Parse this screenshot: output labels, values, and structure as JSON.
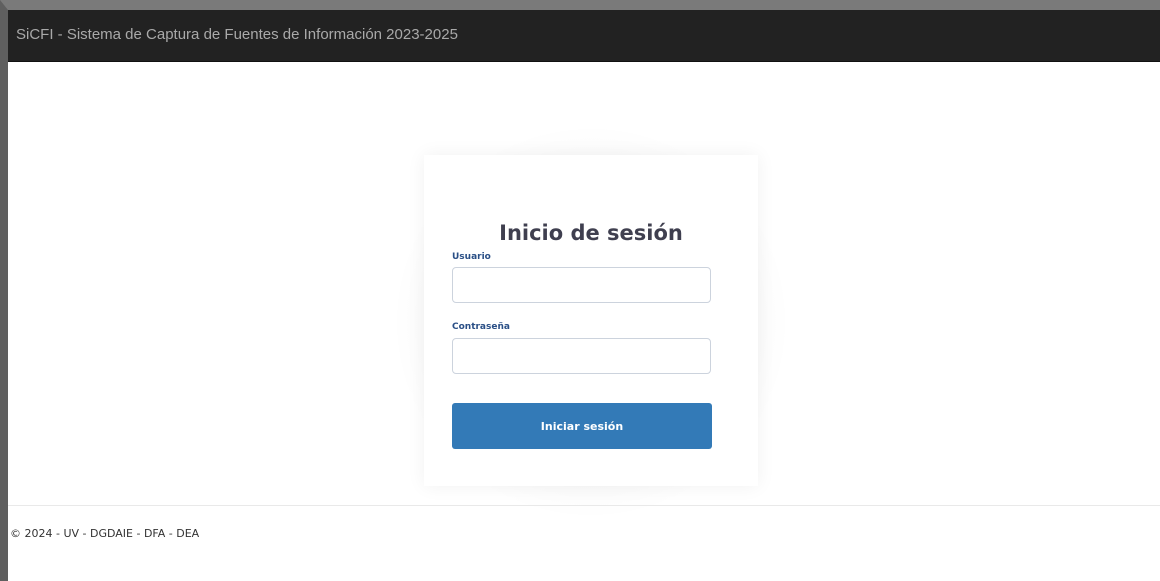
{
  "header": {
    "title": "SiCFI - Sistema de Captura de Fuentes de Información 2023-2025"
  },
  "login": {
    "title": "Inicio de sesión",
    "username": {
      "label": "Usuario",
      "value": ""
    },
    "password": {
      "label": "Contraseña",
      "value": ""
    },
    "submit_label": "Iniciar sesión"
  },
  "footer": {
    "text": "© 2024 - UV - DGDAIE - DFA - DEA"
  },
  "colors": {
    "navbar": "#222222",
    "brand_text": "#a9a9a9",
    "label": "#2a4f86",
    "button": "#337ab7",
    "button_text": "#ffffff"
  }
}
